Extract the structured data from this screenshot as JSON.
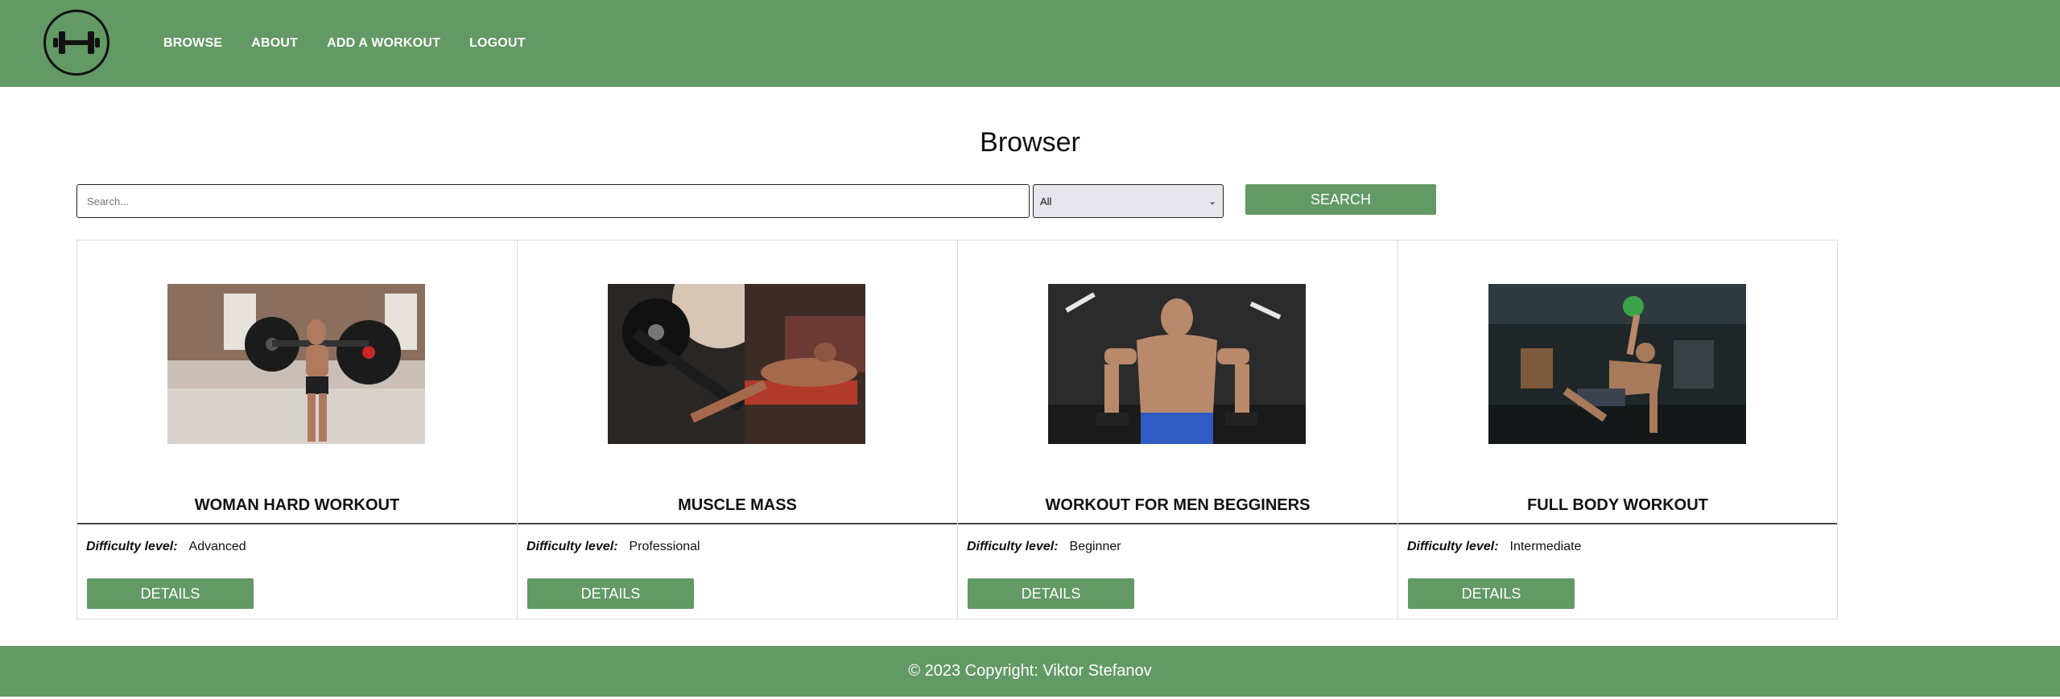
{
  "nav": {
    "items": [
      {
        "label": "BROWSE"
      },
      {
        "label": "ABOUT"
      },
      {
        "label": "ADD A WORKOUT"
      },
      {
        "label": "LOGOUT"
      }
    ]
  },
  "page": {
    "title": "Browser"
  },
  "search": {
    "placeholder": "Search...",
    "value": "",
    "filter_selected": "All",
    "button_label": "SEARCH"
  },
  "cards": [
    {
      "title": "WOMAN HARD WORKOUT",
      "difficulty_label": "Difficulty level:",
      "difficulty": "Advanced",
      "button_label": "DETAILS"
    },
    {
      "title": "MUSCLE MASS",
      "difficulty_label": "Difficulty level:",
      "difficulty": "Professional",
      "button_label": "DETAILS"
    },
    {
      "title": "WORKOUT FOR MEN BEGGINERS",
      "difficulty_label": "Difficulty level:",
      "difficulty": "Beginner",
      "button_label": "DETAILS"
    },
    {
      "title": "FULL BODY WORKOUT",
      "difficulty_label": "Difficulty level:",
      "difficulty": "Intermediate",
      "button_label": "DETAILS"
    }
  ],
  "footer": {
    "text": "© 2023 Copyright: Viktor Stefanov"
  },
  "theme": {
    "brand": "#629964",
    "logo_icon": "dumbbell-icon"
  }
}
